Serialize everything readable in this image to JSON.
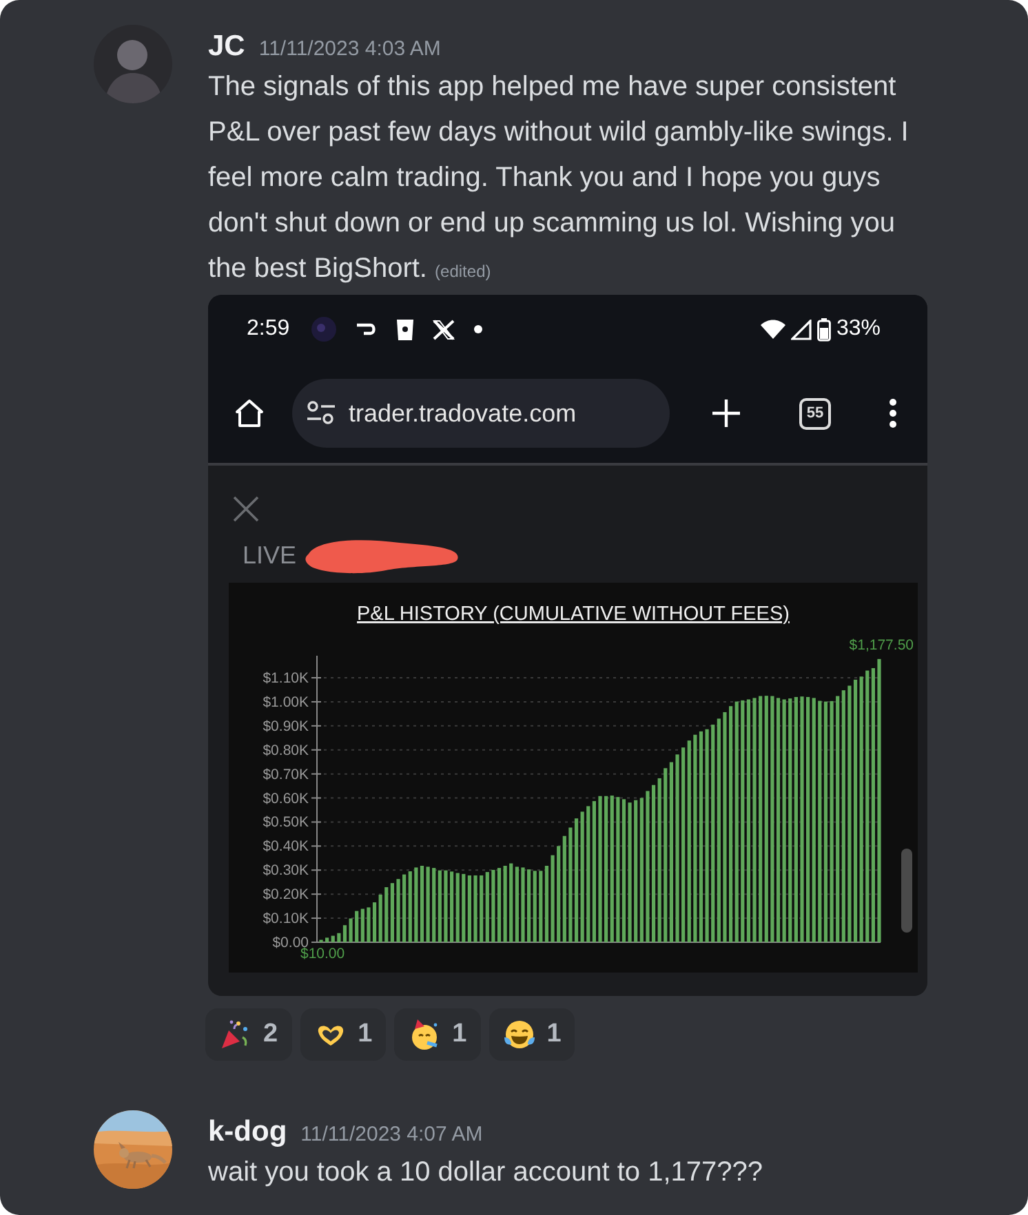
{
  "messages": [
    {
      "author": "JC",
      "avatar": {
        "kind": "silhouette"
      },
      "timestamp": "11/11/2023 4:03 AM",
      "text": "The signals of this app helped me have super consistent P&L over past few days without wild gambly-like swings. I feel more calm trading. Thank you and I hope you guys don't shut down or end up scamming us lol. Wishing you the best BigShort.",
      "edited": "(edited)",
      "attachment": {
        "status_bar": {
          "time": "2:59",
          "battery": "33%"
        },
        "browser": {
          "url": "trader.tradovate.com",
          "tab_count": "55"
        },
        "account_label": "LIVE",
        "chart_data": {
          "type": "bar",
          "title": "P&L HISTORY (CUMULATIVE WITHOUT FEES)",
          "ylim": [
            0,
            1200
          ],
          "grid": true,
          "yticks": [
            {
              "value": 0,
              "label": "$0.00"
            },
            {
              "value": 100,
              "label": "$0.10K"
            },
            {
              "value": 200,
              "label": "$0.20K"
            },
            {
              "value": 300,
              "label": "$0.30K"
            },
            {
              "value": 400,
              "label": "$0.40K"
            },
            {
              "value": 500,
              "label": "$0.50K"
            },
            {
              "value": 600,
              "label": "$0.60K"
            },
            {
              "value": 700,
              "label": "$0.70K"
            },
            {
              "value": 800,
              "label": "$0.80K"
            },
            {
              "value": 900,
              "label": "$0.90K"
            },
            {
              "value": 1000,
              "label": "$1.00K"
            },
            {
              "value": 1100,
              "label": "$1.10K"
            }
          ],
          "series": [
            {
              "color": "#5fa85a",
              "values": [
                10,
                19,
                27,
                38,
                71,
                99,
                130,
                139,
                145,
                166,
                198,
                229,
                246,
                263,
                282,
                295,
                311,
                318,
                314,
                309,
                299,
                299,
                294,
                288,
                284,
                278,
                278,
                278,
                292,
                301,
                309,
                318,
                328,
                314,
                311,
                303,
                297,
                297,
                318,
                362,
                400,
                442,
                477,
                515,
                543,
                566,
                587,
                608,
                608,
                610,
                604,
                595,
                581,
                591,
                600,
                629,
                654,
                682,
                724,
                749,
                781,
                810,
                839,
                863,
                877,
                886,
                905,
                930,
                957,
                982,
                1001,
                1006,
                1010,
                1016,
                1024,
                1025,
                1024,
                1016,
                1010,
                1014,
                1020,
                1022,
                1020,
                1016,
                1004,
                1001,
                1003,
                1024,
                1048,
                1067,
                1092,
                1105,
                1130,
                1140,
                1178
              ]
            }
          ],
          "annotations": [
            {
              "text": "$1,177.50",
              "y": 1178
            },
            {
              "text": "$10.00",
              "y": 10
            }
          ]
        }
      },
      "reactions": [
        {
          "kind": "party-popper",
          "count": "2"
        },
        {
          "kind": "heart-hands",
          "count": "1"
        },
        {
          "kind": "party-face",
          "count": "1"
        },
        {
          "kind": "tears-of-joy",
          "count": "1"
        }
      ]
    },
    {
      "author": "k-dog",
      "timestamp": "11/11/2023 4:07 AM",
      "text": "wait you took a 10 dollar account to 1,177???"
    }
  ]
}
